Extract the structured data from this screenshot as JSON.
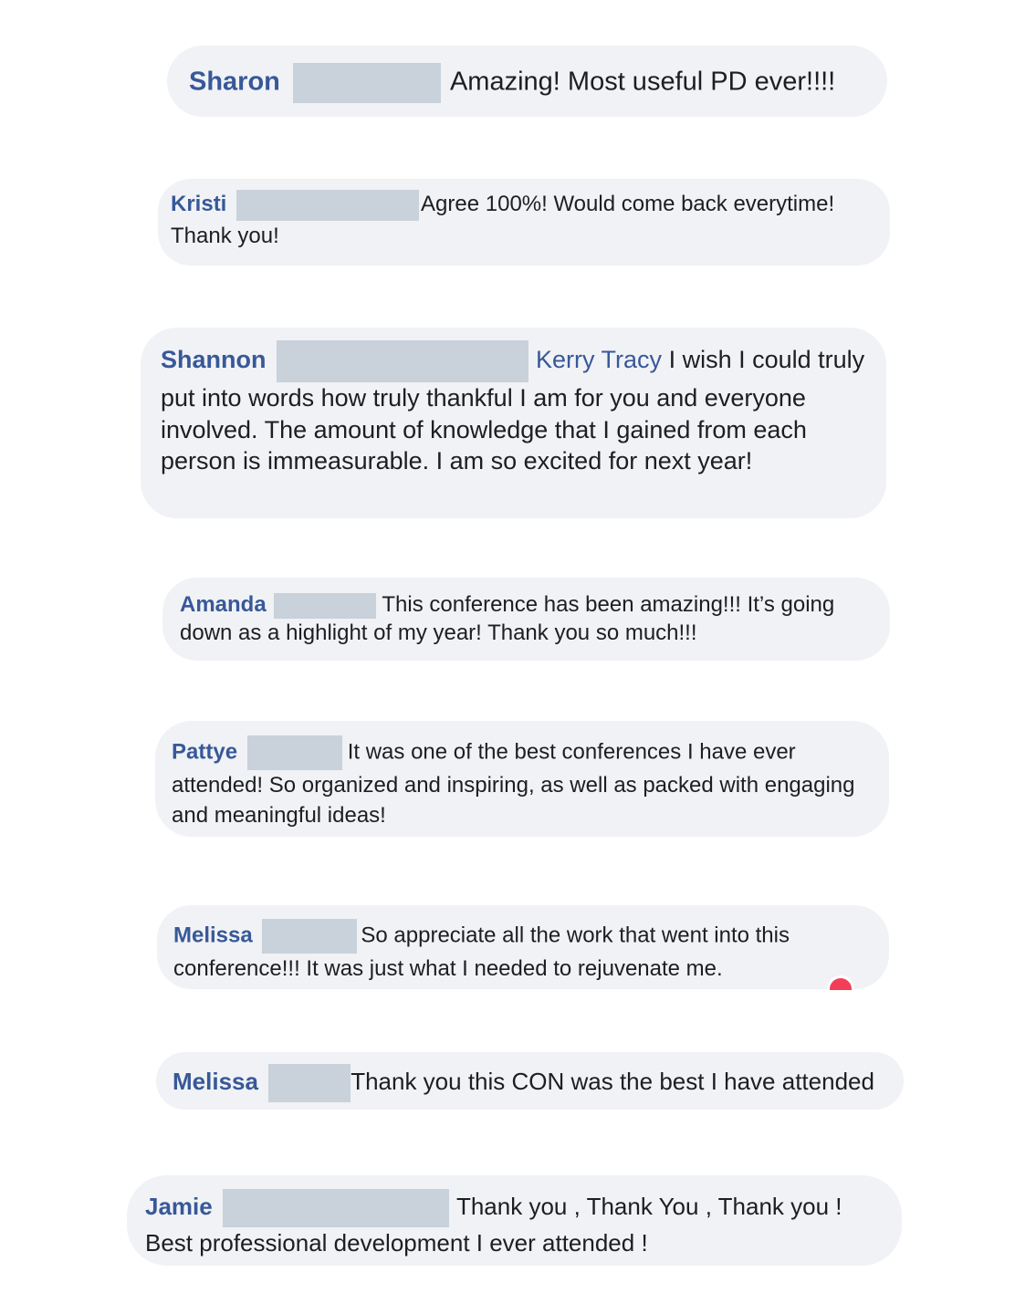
{
  "comments": [
    {
      "name": "Sharon",
      "text": "Amazing! Most useful PD ever!!!!"
    },
    {
      "name": "Kristi",
      "text": "Agree 100%! Would come back everytime! Thank you!"
    },
    {
      "name": "Shannon",
      "mention": "Kerry Tracy",
      "text": "I wish I could truly put into words how truly thankful I am for you and everyone involved. The amount of knowledge that I gained from each person is immeasurable. I am so excited for next year!"
    },
    {
      "name": "Amanda",
      "text": "This conference has been amazing!!! It’s going down as a highlight of my year! Thank you so much!!!"
    },
    {
      "name": "Pattye",
      "text": "It was one of the best conferences I have ever attended! So organized and inspiring, as well as packed with engaging and meaningful ideas!"
    },
    {
      "name": "Melissa",
      "text": "So appreciate all the work that went into this conference!!! It was just what I needed to rejuvenate me."
    },
    {
      "name": "Melissa",
      "text": "Thank you this CON was the best I have attended"
    },
    {
      "name": "Jamie",
      "text": "Thank you , Thank You , Thank you ! Best professional development I ever attended !"
    }
  ],
  "reaction": {
    "icon": "heart-reaction-icon",
    "color": "#f33e58"
  },
  "colors": {
    "name": "#385898",
    "bubble": "#f0f2f5",
    "redaction": "#c9d1db"
  }
}
